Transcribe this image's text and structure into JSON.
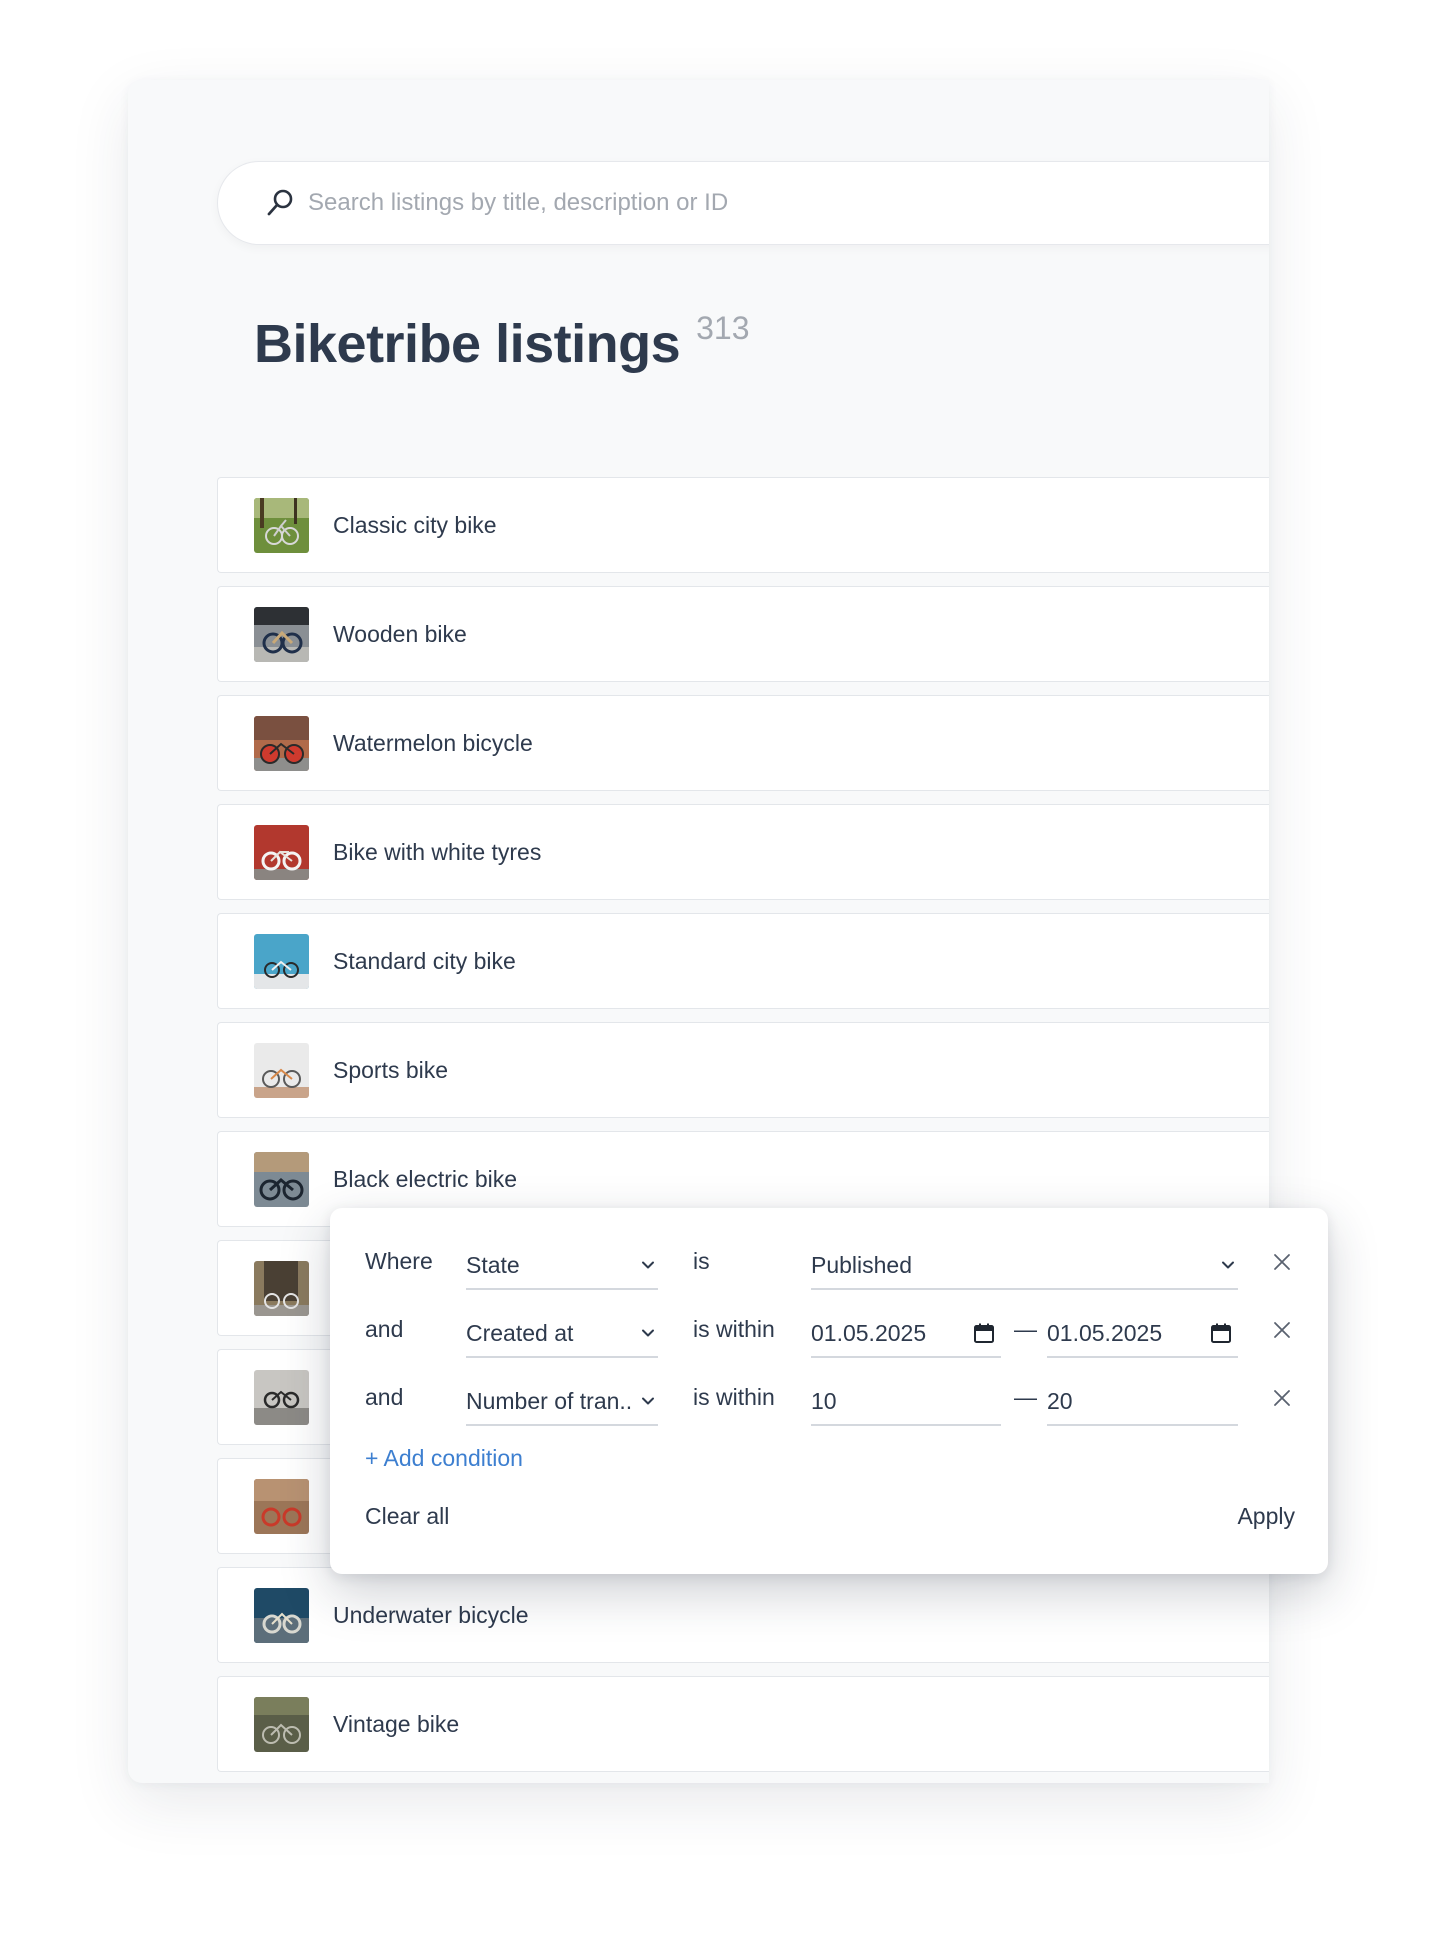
{
  "search": {
    "placeholder": "Search listings by title, description or ID"
  },
  "header": {
    "title": "Biketribe listings",
    "count": "313"
  },
  "listings": [
    {
      "title": "Classic city bike",
      "thumb": "green-park"
    },
    {
      "title": "Wooden bike",
      "thumb": "wooden"
    },
    {
      "title": "Watermelon bicycle",
      "thumb": "watermelon"
    },
    {
      "title": "Bike with white tyres",
      "thumb": "red-wall"
    },
    {
      "title": "Standard city bike",
      "thumb": "blue-wall"
    },
    {
      "title": "Sports bike",
      "thumb": "white-studio"
    },
    {
      "title": "Black electric bike",
      "thumb": "street-grey"
    },
    {
      "title": "",
      "thumb": "doorway"
    },
    {
      "title": "",
      "thumb": "grey-wall"
    },
    {
      "title": "",
      "thumb": "brick-red"
    },
    {
      "title": "Underwater bicycle",
      "thumb": "underwater"
    },
    {
      "title": "Vintage bike",
      "thumb": "vintage"
    }
  ],
  "filter": {
    "rows": [
      {
        "conjunction": "Where",
        "field": "State",
        "operator": "is",
        "value": "Published"
      },
      {
        "conjunction": "and",
        "field": "Created at",
        "operator": "is within",
        "from": "01.05.2025",
        "to": "01.05.2025",
        "separator": "—"
      },
      {
        "conjunction": "and",
        "field": "Number of tran...",
        "operator": "is within",
        "from": "10",
        "to": "20",
        "separator": "—"
      }
    ],
    "add_condition": "+ Add condition",
    "clear_all": "Clear all",
    "apply": "Apply"
  },
  "colors": {
    "accent": "#3d7fd0",
    "title": "#2e3a4d",
    "muted": "#a3a8b0",
    "background": "#f8f9fa"
  }
}
